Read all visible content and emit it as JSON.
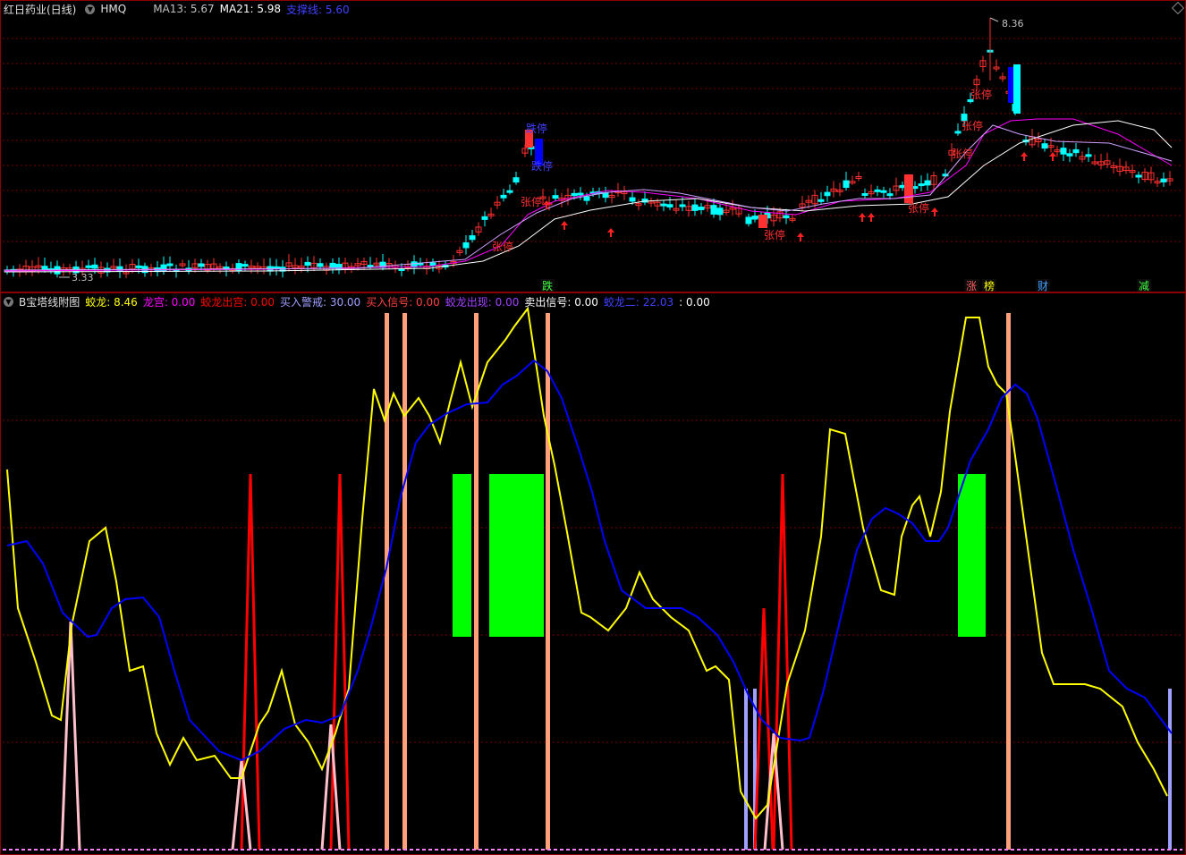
{
  "top_panel": {
    "stock_name": "红日药业(日线)",
    "indicator_tag": "HMQ",
    "ma13_label": "MA13: 5.67",
    "ma21_label": "MA21: 5.98",
    "support_label": "支撑线: 5.60",
    "price_high": "8.36",
    "price_low": "3.33",
    "annotations": [
      "跌停",
      "跌停",
      "张停",
      "张停",
      "张停",
      "张停",
      "张停",
      "张停",
      "张停",
      "张停",
      "张停"
    ],
    "bottom_markers": [
      "跌",
      "涨",
      "榜",
      "财",
      "减"
    ]
  },
  "bottom_panel": {
    "title": "B宝塔线附图",
    "items": [
      {
        "label": "蛟龙:",
        "value": "8.46",
        "color": "#ffff00"
      },
      {
        "label": "龙宫:",
        "value": "0.00",
        "color": "#ff00ff"
      },
      {
        "label": "蛟龙出宫:",
        "value": "0.00",
        "color": "#ff0000"
      },
      {
        "label": "买入警戒:",
        "value": "30.00",
        "color": "#a0a0ff"
      },
      {
        "label": "买入信号:",
        "value": "0.00",
        "color": "#ff4040"
      },
      {
        "label": "蛟龙出现:",
        "value": "0.00",
        "color": "#a040ff"
      },
      {
        "label": "卖出信号:",
        "value": "0.00",
        "color": "#ffffff"
      },
      {
        "label": "蛟龙二:",
        "value": "22.03",
        "color": "#4040ff"
      },
      {
        "label": ":",
        "value": "0.00",
        "color": "#ffffff"
      }
    ]
  },
  "colors": {
    "up": "#ff3030",
    "down": "#00ffff",
    "ma_white": "#ffffff",
    "ma_magenta": "#ff00ff",
    "yellow": "#ffff00",
    "blue": "#0000ff",
    "red_spike": "#ff0000",
    "orange_bar": "#ffa07a",
    "green_block": "#00ff00",
    "lavender": "#a0a0ff",
    "pink": "#ffc0cb"
  }
}
